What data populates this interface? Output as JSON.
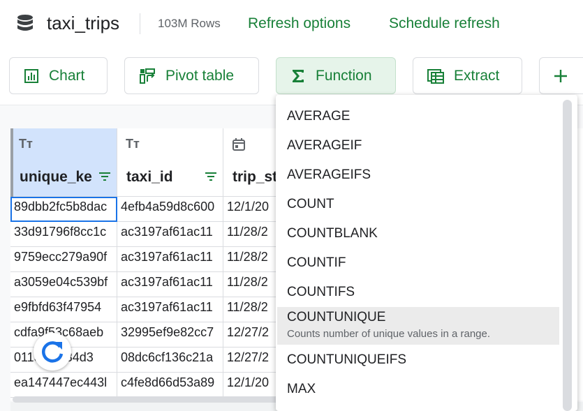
{
  "header": {
    "title": "taxi_trips",
    "row_count": "103M Rows",
    "refresh_options": "Refresh options",
    "schedule_refresh": "Schedule refresh"
  },
  "toolbar": {
    "chart": "Chart",
    "pivot": "Pivot table",
    "function": "Function",
    "extract": "Extract"
  },
  "columns": [
    {
      "name": "unique_ke",
      "type_icon": "Tт"
    },
    {
      "name": "taxi_id",
      "type_icon": "Tт"
    },
    {
      "name": "trip_st",
      "type_icon": "calendar-icon"
    }
  ],
  "rows": [
    [
      "89dbb2fc5b8dac",
      "4efb4a59d8c600",
      "12/1/20"
    ],
    [
      "33d91796f8cc1c",
      "ac3197af61ac11",
      "11/28/2"
    ],
    [
      "9759ecc279a90f",
      "ac3197af61ac11",
      "11/28/2"
    ],
    [
      "a3059e04c539bf",
      "ac3197af61ac11",
      "11/28/2"
    ],
    [
      "e9fbfd63f47954",
      "ac3197af61ac11",
      "11/28/2"
    ],
    [
      "cdfa9f53c68aeb",
      "32995ef9e82cc7",
      "12/27/2"
    ],
    [
      "01135f6884d3",
      "08dc6cf136c21a",
      "12/27/2"
    ],
    [
      "ea147447ec443l",
      "c4fe8d66d53a89",
      "12/1/20"
    ]
  ],
  "functions": [
    {
      "name": "AVERAGE"
    },
    {
      "name": "AVERAGEIF"
    },
    {
      "name": "AVERAGEIFS"
    },
    {
      "name": "COUNT"
    },
    {
      "name": "COUNTBLANK"
    },
    {
      "name": "COUNTIF"
    },
    {
      "name": "COUNTIFS"
    },
    {
      "name": "COUNTUNIQUE",
      "description": "Counts number of unique values in a range.",
      "highlighted": true
    },
    {
      "name": "COUNTUNIQUEIFS"
    },
    {
      "name": "MAX"
    }
  ],
  "colors": {
    "accent_green": "#188038",
    "selected_column": "#d2e3fc",
    "active_cell_border": "#1a73e8"
  }
}
